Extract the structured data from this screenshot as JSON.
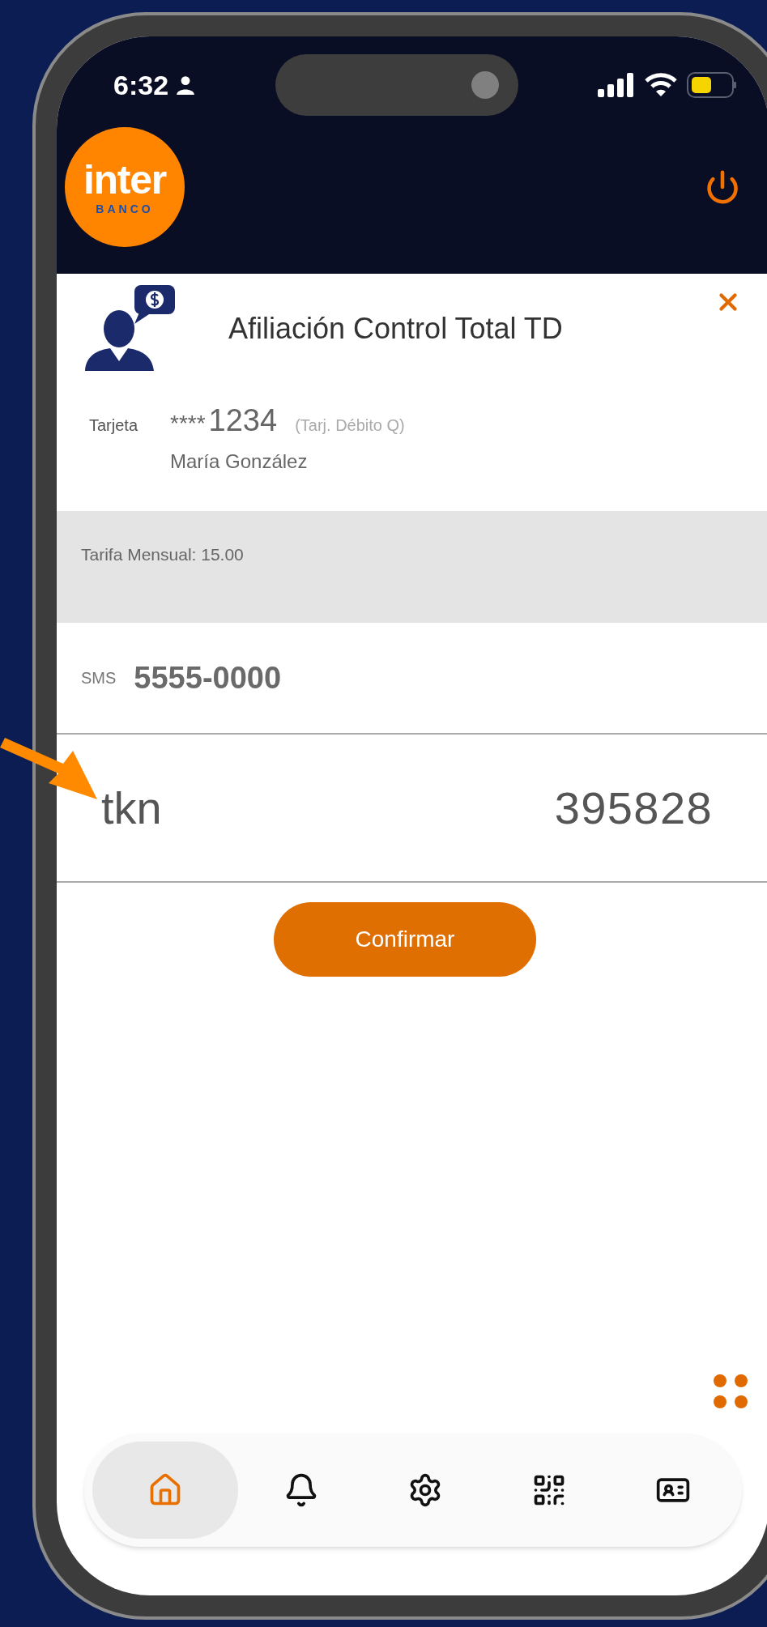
{
  "status_bar": {
    "time": "6:32"
  },
  "header": {
    "logo_word": "inter",
    "logo_sub": "BANCO"
  },
  "dialog": {
    "title": "Afiliación Control Total TD",
    "card": {
      "label": "Tarjeta",
      "mask": "****",
      "number": "1234",
      "type": "(Tarj. Débito Q)",
      "holder": "María González"
    },
    "fee": "Tarifa Mensual: 15.00",
    "sms": {
      "label": "SMS",
      "number": "5555-0000"
    },
    "token": {
      "label": "tkn",
      "value": "395828"
    },
    "confirm_button": "Confirmar"
  },
  "nav": [
    {
      "kind": "home",
      "selected": true
    },
    {
      "kind": "bell",
      "selected": false
    },
    {
      "kind": "settings",
      "selected": false
    },
    {
      "kind": "qr",
      "selected": false
    },
    {
      "kind": "id-card",
      "selected": false
    }
  ]
}
